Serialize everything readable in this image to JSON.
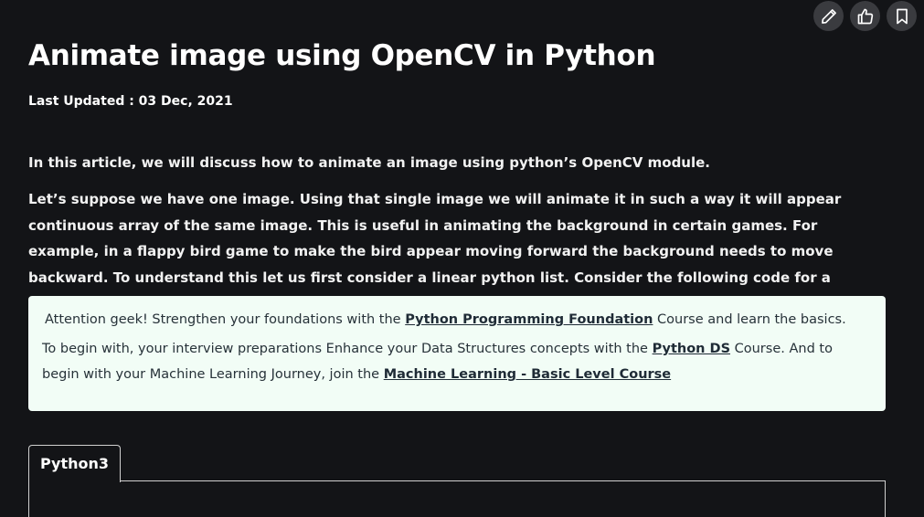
{
  "toolbar": {
    "edit_icon": "pencil-icon",
    "like_icon": "thumbs-up-icon",
    "bookmark_icon": "bookmark-icon"
  },
  "article": {
    "title": "Animate image using OpenCV in Python",
    "last_updated": "Last Updated : 03 Dec, 2021",
    "intro": "In this article, we will discuss how to animate an image using python’s OpenCV module.",
    "paragraph": "Let’s suppose we have one image. Using that single image we will animate it in such a way it will appear continuous array of the same image. This is useful in animating the background in certain games. For example, in a flappy bird game to make the bird appear moving forward the background needs to move backward.  To understand this let us first consider a linear python list. Consider the following code for a moment."
  },
  "callout": {
    "line1_prefix": "Attention geek! Strengthen your foundations with the ",
    "line1_link": "Python Programming Foundation",
    "line1_suffix": " Course and learn the basics.",
    "line2_prefix": "To begin with, your interview preparations Enhance your Data Structures concepts with the ",
    "line2_link1": "Python DS",
    "line2_middle": " Course. And to begin with your Machine Learning Journey, join the ",
    "line2_link2": "Machine Learning - Basic Level Course"
  },
  "code": {
    "tab_label": "Python3"
  },
  "colors": {
    "background": "#131417",
    "callout_bg": "#f2fdf6",
    "button_bg": "#3a3b3f"
  }
}
